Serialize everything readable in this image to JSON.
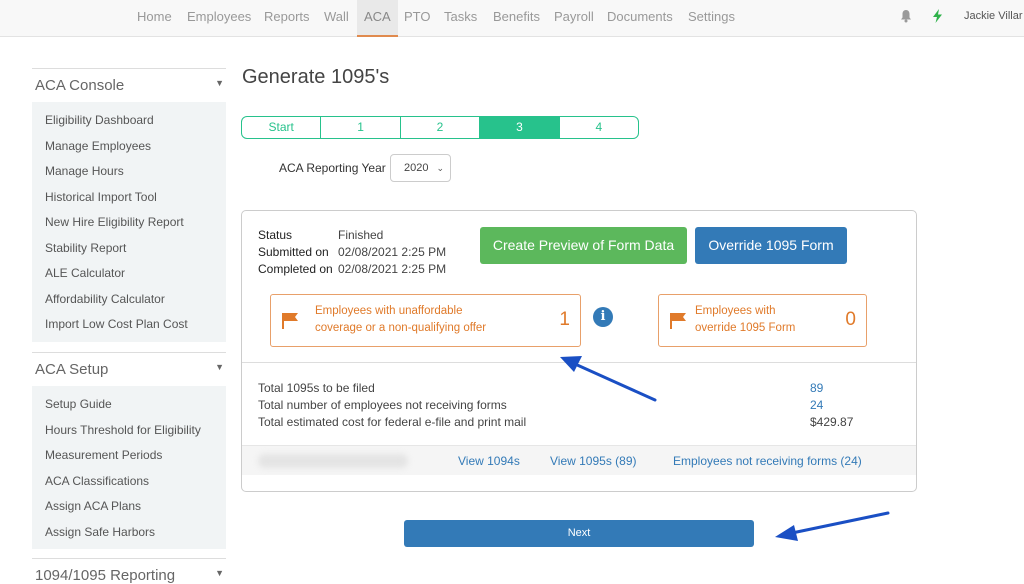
{
  "topnav": {
    "items": [
      "Home",
      "Employees",
      "Reports",
      "Wall",
      "ACA",
      "PTO",
      "Tasks",
      "Benefits",
      "Payroll",
      "Documents",
      "Settings"
    ],
    "active": "ACA",
    "user_name": "Jackie Villar"
  },
  "sidebar": {
    "sections": [
      {
        "title": "ACA Console",
        "items": [
          "Eligibility Dashboard",
          "Manage Employees",
          "Manage Hours",
          "Historical Import Tool",
          "New Hire Eligibility Report",
          "Stability Report",
          "ALE Calculator",
          "Affordability Calculator",
          "Import Low Cost Plan Cost"
        ]
      },
      {
        "title": "ACA Setup",
        "items": [
          "Setup Guide",
          "Hours Threshold for Eligibility",
          "Measurement Periods",
          "ACA Classifications",
          "Assign ACA Plans",
          "Assign Safe Harbors"
        ]
      },
      {
        "title": "1094/1095 Reporting",
        "items": []
      }
    ]
  },
  "main": {
    "title": "Generate 1095's",
    "steps": [
      "Start",
      "1",
      "2",
      "3",
      "4"
    ],
    "active_step": "3",
    "year_label": "ACA Reporting Year",
    "year_value": "2020",
    "status": {
      "status_label": "Status",
      "status_value": "Finished",
      "submitted_label": "Submitted on",
      "submitted_value": "02/08/2021 2:25 PM",
      "completed_label": "Completed on",
      "completed_value": "02/08/2021 2:25 PM"
    },
    "buttons": {
      "preview": "Create Preview of Form Data",
      "override": "Override 1095 Form"
    },
    "alerts": [
      {
        "line1": "Employees with unaffordable",
        "line2": "coverage or a non-qualifying offer",
        "count": "1"
      },
      {
        "line1": "Employees with",
        "line2": "override 1095 Form",
        "count": "0"
      }
    ],
    "info_icon_glyph": "i",
    "totals": [
      {
        "label": "Total 1095s to be filed",
        "value": "89",
        "is_link": true
      },
      {
        "label": "Total number of employees not receiving forms",
        "value": "24",
        "is_link": true
      },
      {
        "label": "Total estimated cost for federal e-file and print mail",
        "value": "$429.87",
        "is_link": false
      }
    ],
    "footer_links": [
      "View 1094s",
      "View 1095s (89)",
      "Employees not receiving forms (24)"
    ],
    "next_label": "Next"
  },
  "colors": {
    "accent_green": "#27c28c",
    "button_green": "#5cb85c",
    "button_blue": "#337ab7",
    "alert_orange": "#e07a2a",
    "annotation_arrow": "#1a4fc4"
  }
}
